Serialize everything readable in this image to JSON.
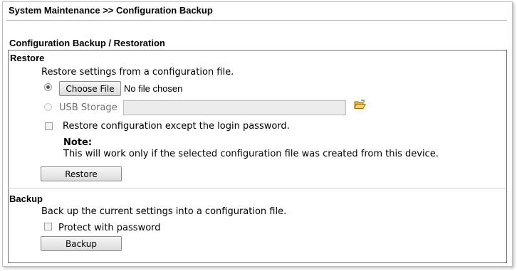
{
  "header": {
    "breadcrumb": "System Maintenance >> Configuration Backup"
  },
  "section": {
    "title": "Configuration Backup / Restoration"
  },
  "restore": {
    "heading": "Restore",
    "description": "Restore settings from a configuration file.",
    "file_option": {
      "selected": true,
      "button_label": "Choose File",
      "status": "No file chosen"
    },
    "usb_option": {
      "selected": false,
      "label": "USB Storage",
      "path_value": "",
      "icon": "folder-open-icon"
    },
    "except_password": {
      "checked": false,
      "label": "Restore configuration except the login password."
    },
    "note_title": "Note:",
    "note_text": "This will work only if the selected configuration file was created from this device.",
    "button_label": "Restore"
  },
  "backup": {
    "heading": "Backup",
    "description": "Back up the current settings into a configuration file.",
    "protect": {
      "checked": false,
      "label": "Protect with password"
    },
    "button_label": "Backup"
  }
}
